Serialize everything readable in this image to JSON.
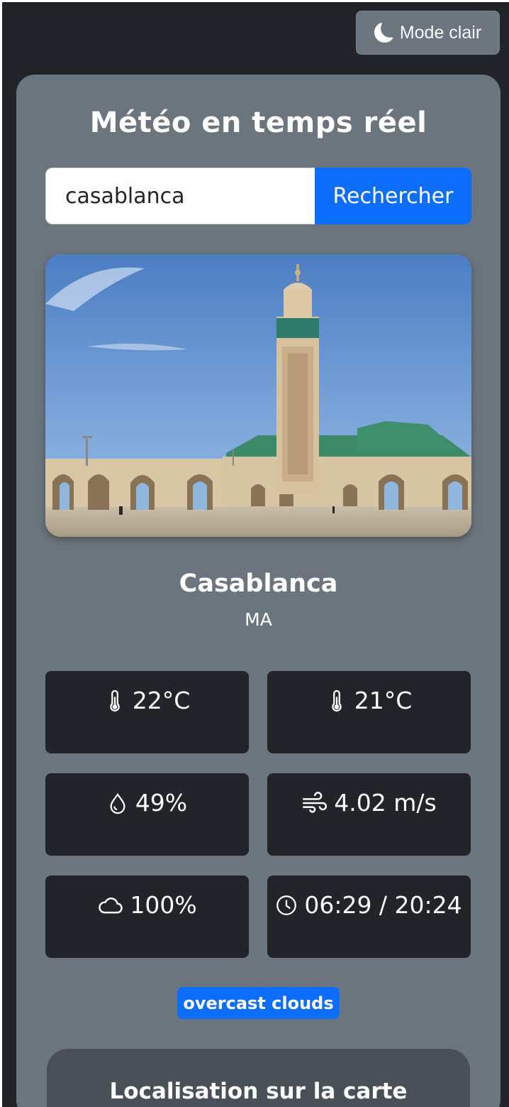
{
  "theme_toggle": {
    "label": "Mode clair",
    "icon": "moon-icon"
  },
  "app": {
    "title": "Météo en temps réel"
  },
  "search": {
    "value": "casablanca",
    "button_label": "Rechercher"
  },
  "photo": {
    "alt": "casablanca"
  },
  "location": {
    "city": "Casablanca",
    "country": "MA"
  },
  "stats": {
    "temperature": {
      "value": "22°C",
      "icon": "thermometer-icon"
    },
    "feels_like": {
      "value": "21°C",
      "icon": "thermometer-icon"
    },
    "humidity": {
      "value": "49%",
      "icon": "droplet-icon"
    },
    "wind": {
      "value": "4.02 m/s",
      "icon": "wind-icon"
    },
    "clouds": {
      "value": "100%",
      "icon": "cloud-icon"
    },
    "sun": {
      "value": "06:29 / 20:24",
      "icon": "clock-icon"
    }
  },
  "description": "overcast clouds",
  "map_section": {
    "title": "Localisation sur la carte"
  },
  "colors": {
    "accent": "#0d6efd",
    "card": "#6c757d",
    "tile": "#212529",
    "background": "#212529"
  }
}
